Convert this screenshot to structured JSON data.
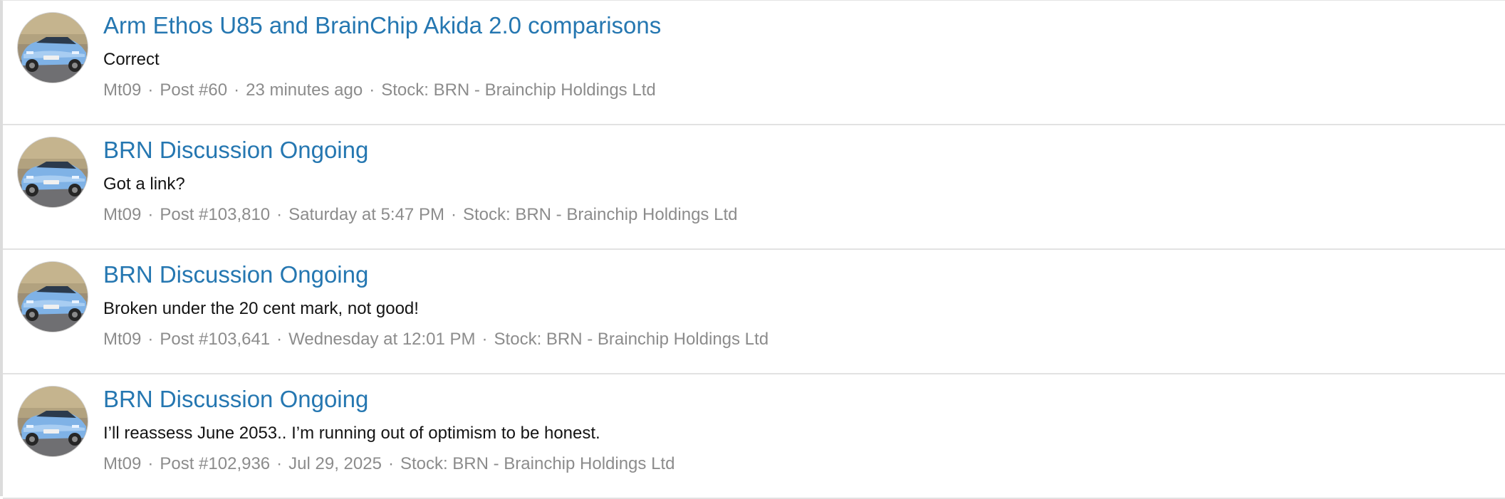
{
  "results": [
    {
      "title": "Arm Ethos U85 and BrainChip Akida 2.0 comparisons",
      "snippet": "Correct",
      "author": "Mt09",
      "post": "Post #60",
      "time": "23 minutes ago",
      "stock": "Stock: BRN - Brainchip Holdings Ltd"
    },
    {
      "title": "BRN Discussion Ongoing",
      "snippet": "Got a link?",
      "author": "Mt09",
      "post": "Post #103,810",
      "time": "Saturday at 5:47 PM",
      "stock": "Stock: BRN - Brainchip Holdings Ltd"
    },
    {
      "title": "BRN Discussion Ongoing",
      "snippet": "Broken under the 20 cent mark, not good!",
      "author": "Mt09",
      "post": "Post #103,641",
      "time": "Wednesday at 12:01 PM",
      "stock": "Stock: BRN - Brainchip Holdings Ltd"
    },
    {
      "title": "BRN Discussion Ongoing",
      "snippet": "I’ll reassess June 2053.. I’m running out of optimism to be honest.",
      "author": "Mt09",
      "post": "Post #102,936",
      "time": "Jul 29, 2025",
      "stock": "Stock: BRN - Brainchip Holdings Ltd"
    }
  ],
  "separator": "·",
  "colors": {
    "link": "#2577b1",
    "meta": "#8c8c8c",
    "snippet": "#141414",
    "avatar_car": "#7fb2e6",
    "divider": "#e2e2e2"
  },
  "icons": {
    "avatar": "user-avatar-car-photo"
  }
}
